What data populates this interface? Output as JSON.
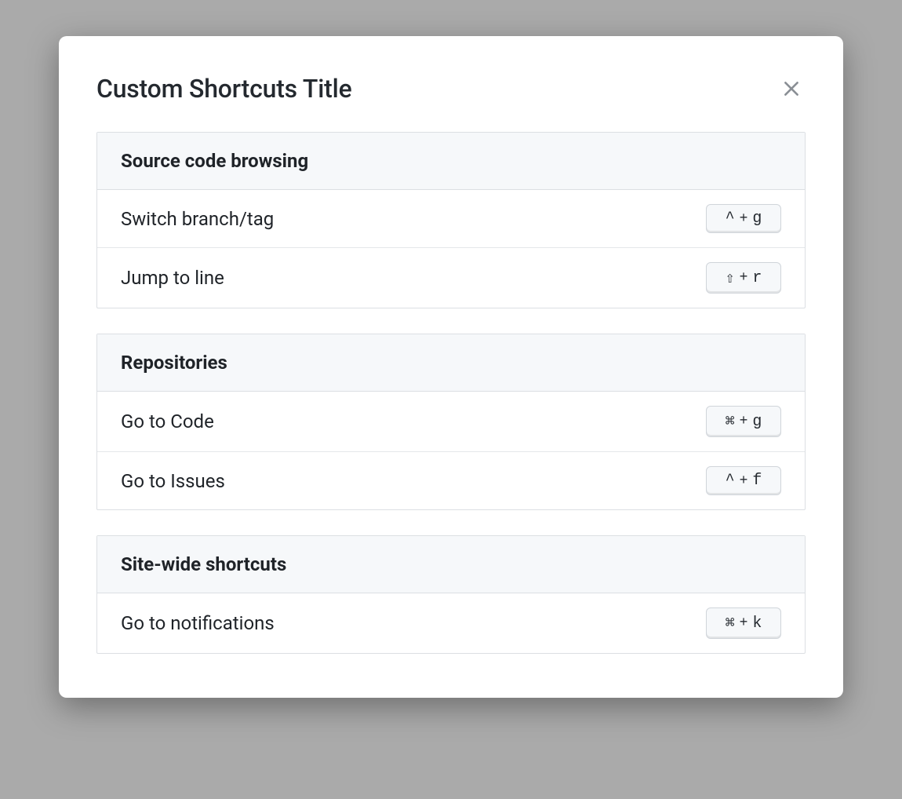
{
  "title": "Custom Shortcuts Title",
  "separator": "+",
  "groups": [
    {
      "title": "Source code browsing",
      "items": [
        {
          "label": "Switch branch/tag",
          "mod": "^",
          "key": "g"
        },
        {
          "label": "Jump to line",
          "mod": "⇧",
          "key": "r"
        }
      ]
    },
    {
      "title": "Repositories",
      "items": [
        {
          "label": "Go to Code",
          "mod": "⌘",
          "key": "g"
        },
        {
          "label": "Go to Issues",
          "mod": "^",
          "key": "f"
        }
      ]
    },
    {
      "title": "Site-wide shortcuts",
      "items": [
        {
          "label": "Go to notifications",
          "mod": "⌘",
          "key": "k"
        }
      ]
    }
  ]
}
